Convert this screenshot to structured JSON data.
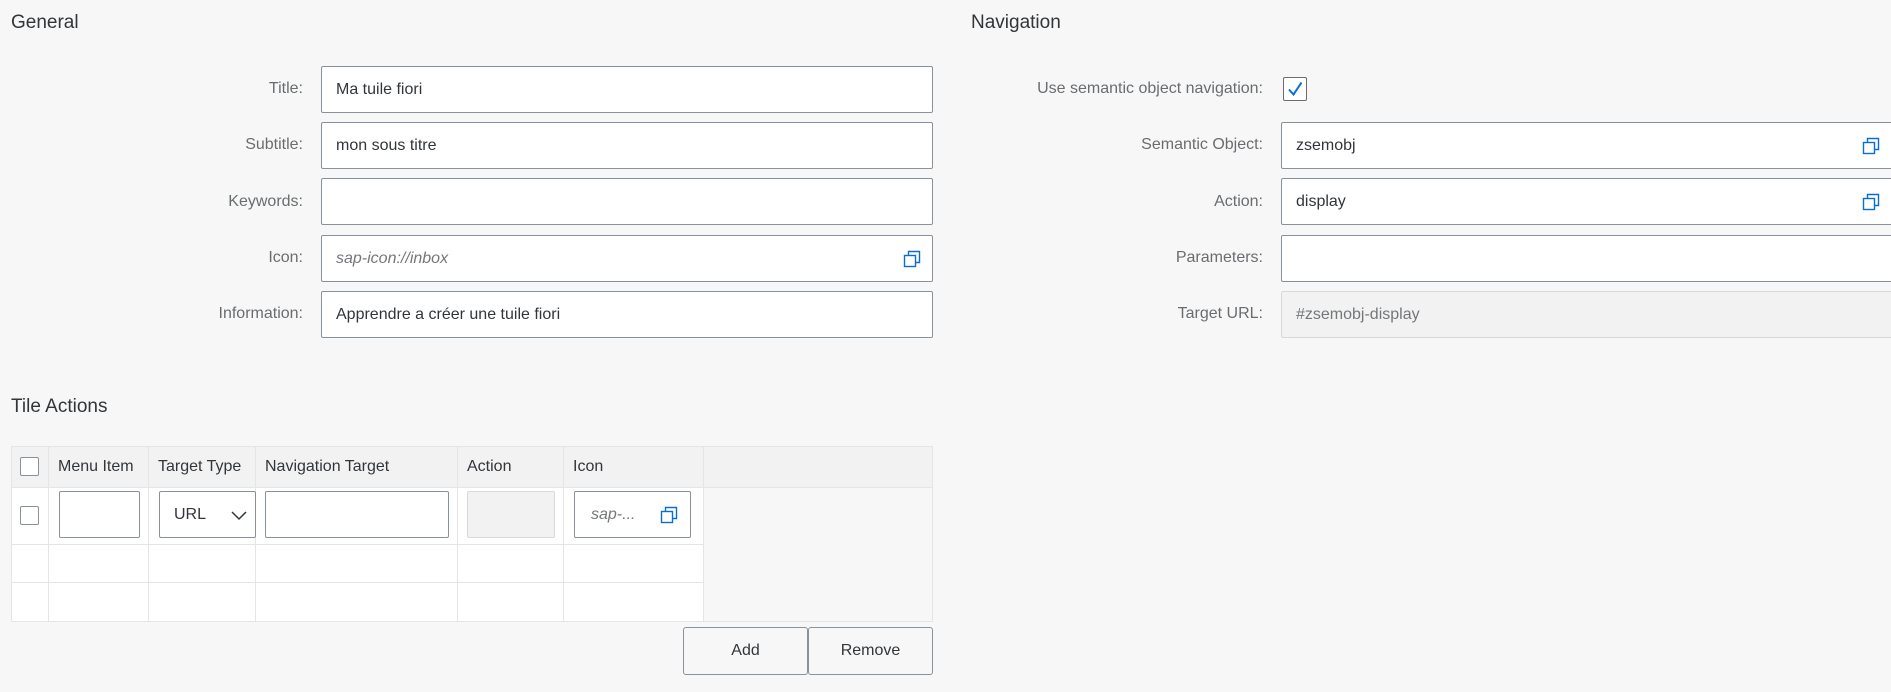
{
  "general": {
    "title": "General",
    "fields": {
      "title": {
        "label": "Title:",
        "value": "Ma tuile fiori"
      },
      "subtitle": {
        "label": "Subtitle:",
        "value": "mon sous titre"
      },
      "keywords": {
        "label": "Keywords:",
        "value": ""
      },
      "icon": {
        "label": "Icon:",
        "placeholder": "sap-icon://inbox"
      },
      "information": {
        "label": "Information:",
        "value": "Apprendre a créer une tuile fiori"
      }
    }
  },
  "navigation": {
    "title": "Navigation",
    "use_semantic": {
      "label": "Use semantic object navigation:",
      "checked": true
    },
    "semantic_object": {
      "label": "Semantic Object:",
      "value": "zsemobj"
    },
    "action": {
      "label": "Action:",
      "value": "display"
    },
    "parameters": {
      "label": "Parameters:",
      "value": ""
    },
    "target_url": {
      "label": "Target URL:",
      "value": "#zsemobj-display"
    }
  },
  "tile_actions": {
    "title": "Tile Actions",
    "columns": [
      "Menu Item",
      "Target Type",
      "Navigation Target",
      "Action",
      "Icon"
    ],
    "row1": {
      "target_type": "URL",
      "icon_placeholder": "sap-..."
    },
    "add_label": "Add",
    "remove_label": "Remove"
  },
  "colors": {
    "accent": "#0a6ed1",
    "text": "#32363a",
    "label": "#6a6d70",
    "border": "#89919a"
  },
  "icons": {
    "value_help": "value-help-icon",
    "check": "check-icon",
    "dropdown": "chevron-down-icon"
  }
}
